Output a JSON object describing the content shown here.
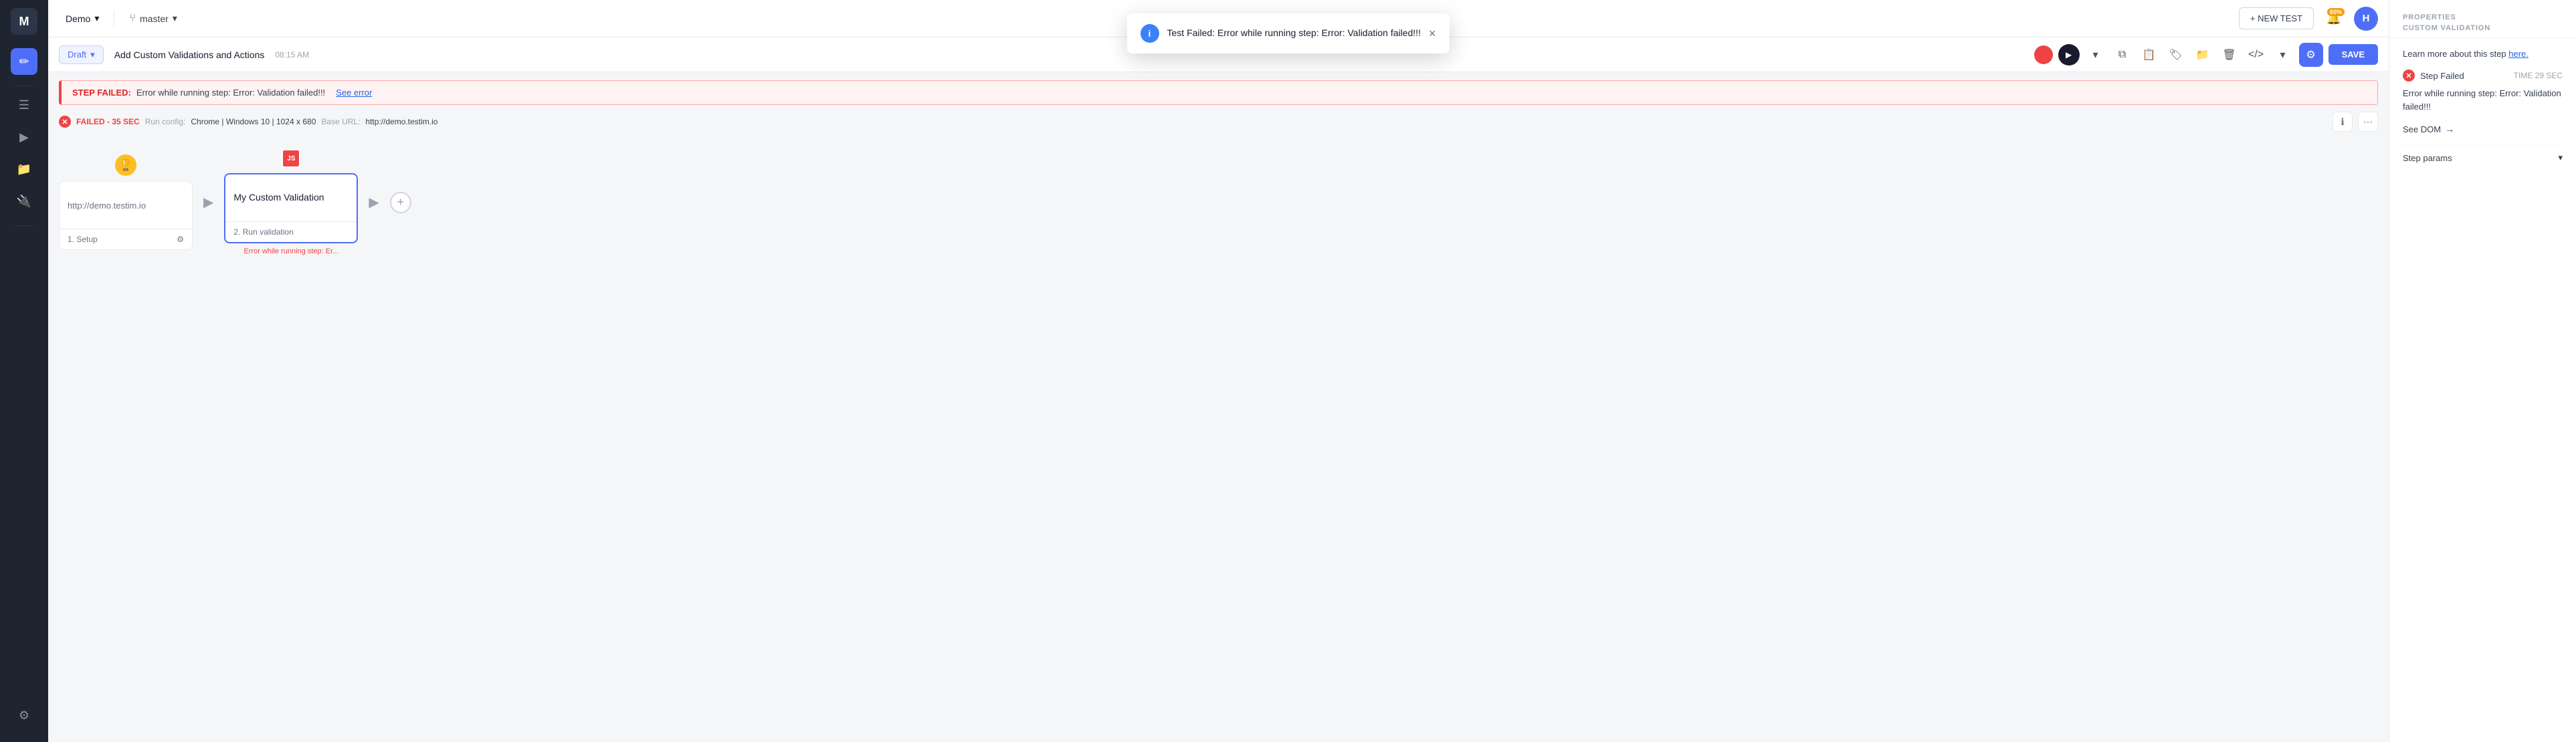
{
  "sidebar": {
    "logo": "M",
    "icons": [
      {
        "name": "edit-icon",
        "symbol": "✏️",
        "active": true
      },
      {
        "name": "minus-icon",
        "symbol": "—",
        "active": false
      },
      {
        "name": "list-icon",
        "symbol": "☰",
        "active": false
      },
      {
        "name": "play-icon",
        "symbol": "▶",
        "active": false
      },
      {
        "name": "folder-icon",
        "symbol": "🗂",
        "active": false
      },
      {
        "name": "settings-icon",
        "symbol": "⚙",
        "active": false
      },
      {
        "name": "gear-bottom-icon",
        "symbol": "⚙",
        "active": false
      }
    ]
  },
  "topbar": {
    "demo_label": "Demo",
    "branch_label": "master",
    "new_test_label": "+ NEW TEST",
    "notif_badge": "60%",
    "avatar_initial": "H"
  },
  "toolbar": {
    "draft_label": "Draft",
    "title": "Add Custom Validations and Actions",
    "time": "08:15 AM",
    "save_label": "SAVE"
  },
  "error_banner": {
    "prefix": "STEP FAILED:",
    "message": "Error while running step: Error: Validation failed!!!",
    "link_label": "See error"
  },
  "run_info": {
    "status": "FAILED - 35 SEC",
    "config_label": "Run config:",
    "config_value": "Chrome | Windows 10 | 1024 x 680",
    "base_url_label": "Base URL:",
    "base_url_value": "http://demo.testim.io"
  },
  "steps": [
    {
      "id": "step-1",
      "type": "setup",
      "url": "http://demo.testim.io",
      "footer_label": "1. Setup",
      "has_settings": true
    },
    {
      "id": "step-2",
      "type": "validation",
      "title": "My Custom Validation",
      "footer_label": "2. Run validation",
      "error_text": "Error while running step: Er...",
      "active": true,
      "has_js_badge": true
    }
  ],
  "right_panel": {
    "title": "PROPERTIES",
    "subtitle": "CUSTOM VALIDATION",
    "learn_text": "Learn more about this step ",
    "learn_link": "here.",
    "step_failed_label": "Step Failed",
    "step_failed_time": "TIME 29 SEC",
    "error_detail": "Error while running step: Error: Valida­tion failed!!!",
    "see_dom_label": "See DOM",
    "step_params_label": "Step params"
  },
  "toast": {
    "message": "Test Failed: Error while running step: Error: Validation failed!!!",
    "icon": "i",
    "close": "×"
  }
}
